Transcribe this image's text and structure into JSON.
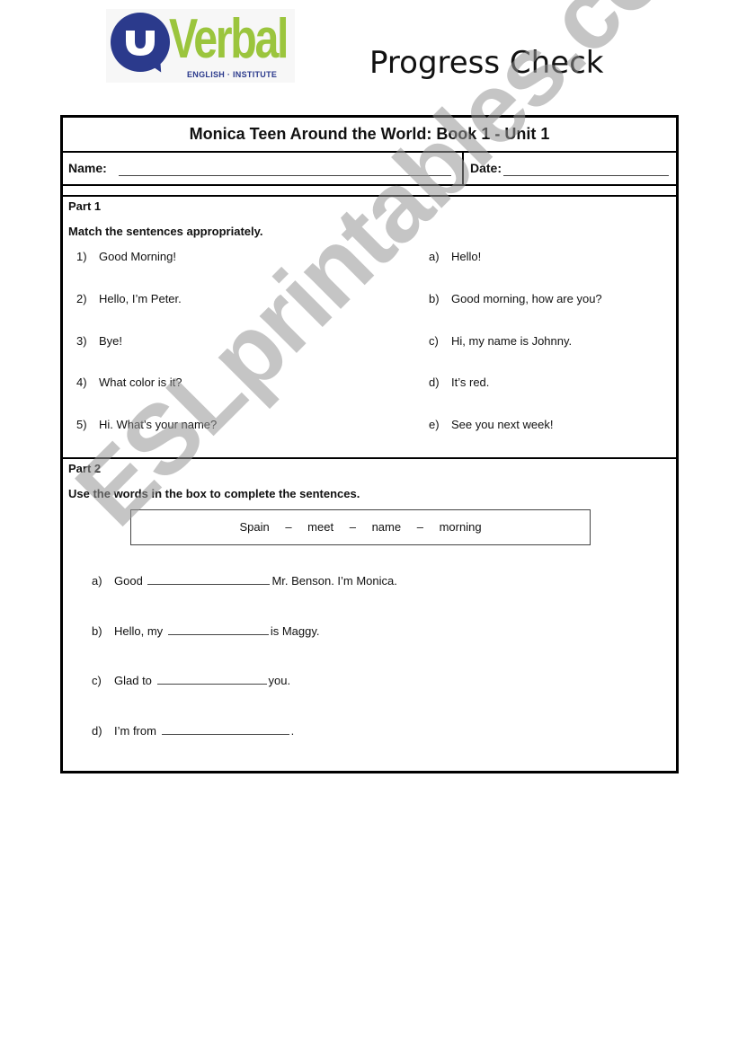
{
  "logo": {
    "brand": "Verbal",
    "subtitle": "ENGLISH · INSTITUTE",
    "brand_color": "#9bc53d",
    "bubble_color": "#2b3a8c"
  },
  "header": {
    "title": "Progress Check"
  },
  "sheet": {
    "title": "Monica Teen Around the World: Book 1 - Unit 1",
    "name_label": "Name:",
    "date_label": "Date:"
  },
  "part1": {
    "label": "Part 1",
    "instruction": "Match the sentences appropriately.",
    "left": [
      {
        "num": "1)",
        "text": "Good Morning!"
      },
      {
        "num": "2)",
        "text": "Hello, I’m Peter."
      },
      {
        "num": "3)",
        "text": "Bye!"
      },
      {
        "num": "4)",
        "text": "What color is it?"
      },
      {
        "num": "5)",
        "text": "Hi. What’s your name?"
      }
    ],
    "right": [
      {
        "num": "a)",
        "text": "Hello!"
      },
      {
        "num": "b)",
        "text": "Good morning, how are you?"
      },
      {
        "num": "c)",
        "text": "Hi, my name is Johnny."
      },
      {
        "num": "d)",
        "text": "It’s red."
      },
      {
        "num": "e)",
        "text": "See you next week!"
      }
    ]
  },
  "part2": {
    "label": "Part 2",
    "instruction": "Use the words in the box to complete the sentences.",
    "words": [
      "Spain",
      "meet",
      "name",
      "morning"
    ],
    "separator": "–",
    "sentences": [
      {
        "num": "a)",
        "before": "Good",
        "after": "Mr. Benson. I’m Monica."
      },
      {
        "num": "b)",
        "before": "Hello, my",
        "after": "is Maggy."
      },
      {
        "num": "c)",
        "before": "Glad to",
        "after": "you."
      },
      {
        "num": "d)",
        "before": "I’m from",
        "after": "."
      }
    ]
  },
  "watermark": {
    "text": "ESLprintables.com"
  }
}
